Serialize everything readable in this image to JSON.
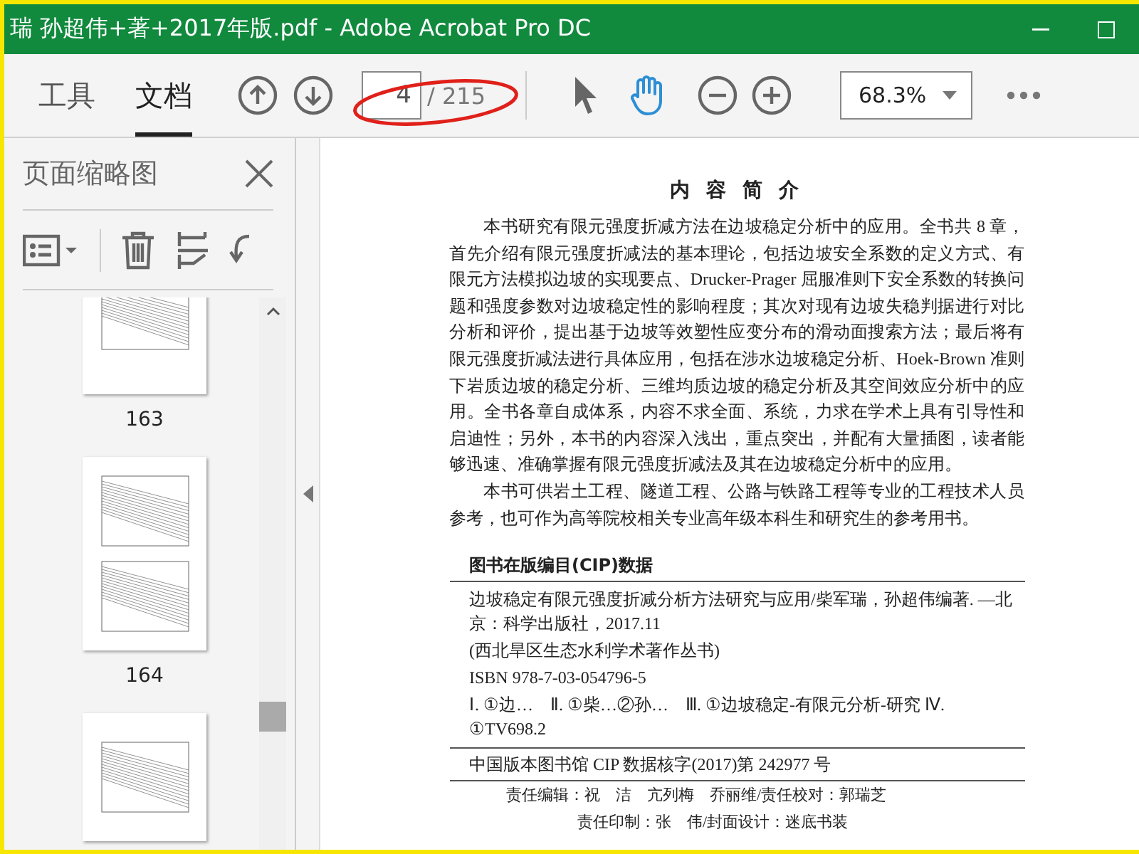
{
  "window": {
    "title": "瑞 孙超伟+著+2017年版.pdf - Adobe Acrobat Pro DC"
  },
  "tabs": [
    {
      "label": "工具",
      "selected": false
    },
    {
      "label": "文档",
      "selected": true
    }
  ],
  "page_nav": {
    "current": "4",
    "total": "/ 215"
  },
  "tools": [
    {
      "kind": "select",
      "selected": false
    },
    {
      "kind": "hand",
      "selected": true
    }
  ],
  "zoom": {
    "value": "68.3%"
  },
  "sidebar": {
    "title": "页面缩略图",
    "thumbnails": [
      {
        "label": "163",
        "kind": "single",
        "cut_top": true
      },
      {
        "label": "164",
        "kind": "double",
        "cut_top": false
      },
      {
        "kind": "single",
        "cut_top": false
      }
    ]
  },
  "document": {
    "heading": "内 容 简 介",
    "paragraphs": [
      "本书研究有限元强度折减方法在边坡稳定分析中的应用。全书共 8 章，首先介绍有限元强度折减法的基本理论，包括边坡安全系数的定义方式、有限元方法模拟边坡的实现要点、Drucker-Prager 屈服准则下安全系数的转换问题和强度参数对边坡稳定性的影响程度；其次对现有边坡失稳判据进行对比分析和评价，提出基于边坡等效塑性应变分布的滑动面搜索方法；最后将有限元强度折减法进行具体应用，包括在涉水边坡稳定分析、Hoek-Brown 准则下岩质边坡的稳定分析、三维均质边坡的稳定分析及其空间效应分析中的应用。全书各章自成体系，内容不求全面、系统，力求在学术上具有引导性和启迪性；另外，本书的内容深入浅出，重点突出，并配有大量插图，读者能够迅速、准确掌握有限元强度折减法及其在边坡稳定分析中的应用。",
      "本书可供岩土工程、隧道工程、公路与铁路工程等专业的工程技术人员参考，也可作为高等院校相关专业高年级本科生和研究生的参考用书。"
    ],
    "cip_title": "图书在版编目(CIP)数据",
    "cip_entries": [
      "边坡稳定有限元强度折减分析方法研究与应用/柴军瑞，孙超伟编著. —北京：科学出版社，2017.11",
      "(西北旱区生态水利学术著作丛书)",
      "ISBN 978-7-03-054796-5",
      "Ⅰ. ①边…　Ⅱ. ①柴…②孙…　Ⅲ. ①边坡稳定-有限元分析-研究 Ⅳ. ①TV698.2"
    ],
    "cip_number": "中国版本图书馆 CIP 数据核字(2017)第 242977 号",
    "credits": [
      "责任编辑：祝　洁　亢列梅　乔丽维/责任校对：郭瑞芝",
      "责任印制：张　伟/封面设计：迷底书装"
    ]
  }
}
